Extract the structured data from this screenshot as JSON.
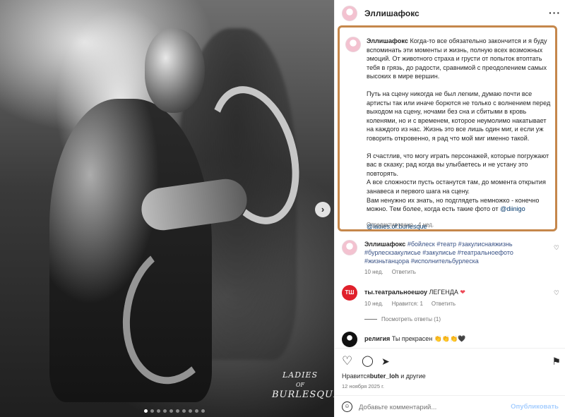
{
  "photo": {
    "next_icon": "chevron-right-icon",
    "next_glyph": "›",
    "dots_count": 10,
    "active_dot": 0,
    "brand_lines": [
      "LADIES",
      "OF",
      "BURLESQUE"
    ]
  },
  "header": {
    "username": "Эллишафокс",
    "more_icon": "more-horizontal-icon",
    "more_glyph": "···"
  },
  "caption": {
    "username": "Эллишафокс",
    "p1": "Когда-то все обязательно закончится и я буду вспоминать эти моменты и жизнь, полную всех возможных эмоций. От животного страха и грусти от попыток втоптать тебя в грязь, до радости, сравнимой с преодолением самых высоких в мире вершин.",
    "p2": "Путь на сцену никогда не был легким, думаю почти все артисты так или иначе борются не только с волнением перед выходом на сцену, ночами без сна и сбитыми в кровь коленями, но и с временем, которое неумолимо накатывает на каждого из нас. Жизнь это все лишь один миг, и если уж говорить откровенно, я рад что мой миг именно такой.",
    "p3": "Я счастлив, что могу играть персонажей, которые погружают вас в сказку; рад когда вы улыбаетесь и не устану это повторять.",
    "p4": "А все сложности пусть останутся там, до момента открытия занавеса и первого шага на сцену.",
    "p5_before": "Вам ненужно их знать, но подглядеть немножко - конечно можно. Тем более, когда есть такие фото от ",
    "p5_mention": "@diinigo",
    "mention_link": "@ladies.of.burlesque",
    "edited": "Отредактировано · 4 нед."
  },
  "comments": [
    {
      "username": "Эллишафокс",
      "text": "#бойлеск #театр #закулиснаяжизнь #бурлескзакулисье #закулисье #театральноефото #жизньтанцора #исполнительбурлеска",
      "time": "10 нед.",
      "reply": "Ответить"
    },
    {
      "username": "ты.театральноешоу",
      "text": "ЛЕГЕНДА",
      "emoji": "❤",
      "avatar_text": "ТШ",
      "time": "10 нед.",
      "likes": "Нравится: 1",
      "reply": "Ответить",
      "view_replies": "Посмотреть ответы (1)"
    },
    {
      "username": "религия",
      "text": "Ты прекрасен",
      "emoji": "👏👏👏🖤"
    }
  ],
  "actions": {
    "like_icon": "heart-icon",
    "like_glyph": "♡",
    "comment_icon": "comment-icon",
    "comment_glyph": "◯",
    "share_icon": "share-icon",
    "share_glyph": "➤",
    "save_icon": "bookmark-icon",
    "save_glyph": "⚑"
  },
  "likes": {
    "prefix": "Нравится",
    "user": "buter_loh",
    "suffix": " и другие"
  },
  "post_date": "12 ноября 2025 г.",
  "comment_box": {
    "emoji_icon": "smile-icon",
    "emoji_glyph": "☺",
    "placeholder": "Добавьте комментарий...",
    "publish": "Опубликовать"
  },
  "colors": {
    "accent_link": "#00376b",
    "hashtag": "#385185",
    "publish_disabled": "#a6ceff",
    "highlight_border": "#c5874b",
    "heart_red": "#ed4956"
  }
}
